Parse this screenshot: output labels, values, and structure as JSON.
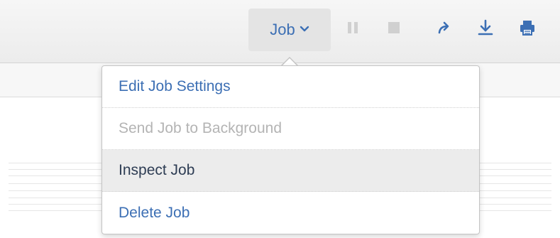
{
  "toolbar": {
    "job_menu": {
      "label": "Job",
      "icon": "chevron-down-icon",
      "expanded": true
    },
    "buttons": [
      {
        "name": "pause",
        "icon": "pause-icon",
        "enabled": false
      },
      {
        "name": "stop",
        "icon": "stop-icon",
        "enabled": false
      },
      {
        "name": "share",
        "icon": "share-arrow-icon",
        "enabled": true
      },
      {
        "name": "export",
        "icon": "download-icon",
        "enabled": true
      },
      {
        "name": "print",
        "icon": "printer-icon",
        "enabled": true
      }
    ]
  },
  "job_dropdown": {
    "items": [
      {
        "label": "Edit Job Settings",
        "enabled": true,
        "highlighted": false
      },
      {
        "label": "Send Job to Background",
        "enabled": false,
        "highlighted": false
      },
      {
        "label": "Inspect Job",
        "enabled": true,
        "highlighted": true
      },
      {
        "label": "Delete Job",
        "enabled": true,
        "highlighted": false
      }
    ]
  },
  "colors": {
    "link_blue": "#3c6fb4",
    "disabled_gray": "#b4b4b4",
    "highlight_bg": "#ececec",
    "dark_text": "#2e3d54",
    "toolbar_bg": "#efefef",
    "button_bg": "#e4e4e4"
  }
}
